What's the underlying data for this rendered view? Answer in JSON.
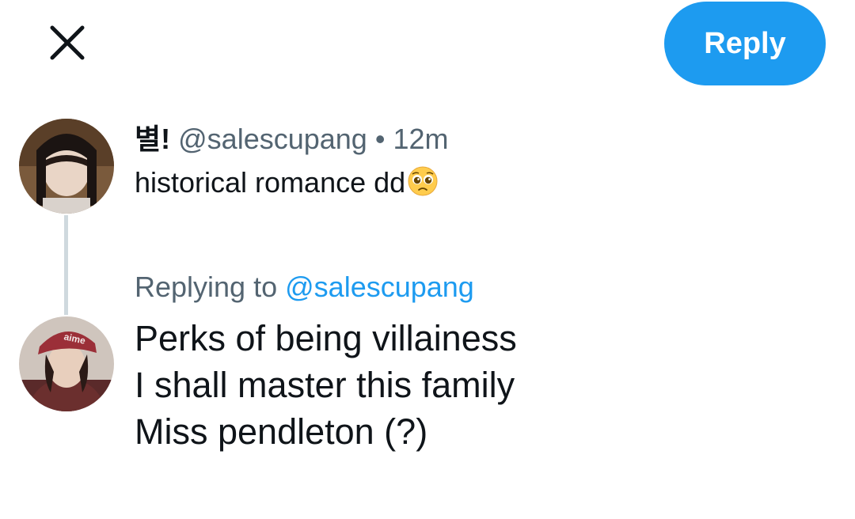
{
  "toolbar": {
    "close_icon": "close-icon",
    "reply_label": "Reply",
    "accent_color": "#1d9bf0"
  },
  "original_tweet": {
    "display_name": "별!",
    "handle": "@salescupang",
    "separator": "•",
    "time": "12m",
    "text": "historical romance dd",
    "emoji": "pleading-face-emoji"
  },
  "reply_compose": {
    "replying_prefix": "Replying to",
    "replying_handle": "@salescupang",
    "lines": [
      "Perks of being villainess",
      "I shall master this family",
      "Miss pendleton (?)"
    ]
  }
}
